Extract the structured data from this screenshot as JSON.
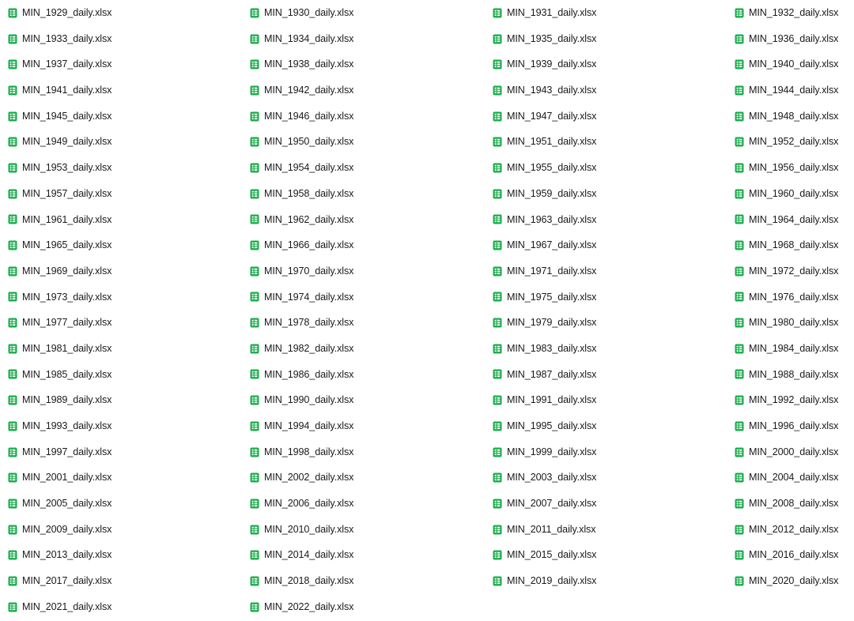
{
  "file_icon": "spreadsheet-file-icon",
  "icon_color": "#1aab4b",
  "files": [
    "MIN_1929_daily.xlsx",
    "MIN_1930_daily.xlsx",
    "MIN_1931_daily.xlsx",
    "MIN_1932_daily.xlsx",
    "MIN_1933_daily.xlsx",
    "MIN_1934_daily.xlsx",
    "MIN_1935_daily.xlsx",
    "MIN_1936_daily.xlsx",
    "MIN_1937_daily.xlsx",
    "MIN_1938_daily.xlsx",
    "MIN_1939_daily.xlsx",
    "MIN_1940_daily.xlsx",
    "MIN_1941_daily.xlsx",
    "MIN_1942_daily.xlsx",
    "MIN_1943_daily.xlsx",
    "MIN_1944_daily.xlsx",
    "MIN_1945_daily.xlsx",
    "MIN_1946_daily.xlsx",
    "MIN_1947_daily.xlsx",
    "MIN_1948_daily.xlsx",
    "MIN_1949_daily.xlsx",
    "MIN_1950_daily.xlsx",
    "MIN_1951_daily.xlsx",
    "MIN_1952_daily.xlsx",
    "MIN_1953_daily.xlsx",
    "MIN_1954_daily.xlsx",
    "MIN_1955_daily.xlsx",
    "MIN_1956_daily.xlsx",
    "MIN_1957_daily.xlsx",
    "MIN_1958_daily.xlsx",
    "MIN_1959_daily.xlsx",
    "MIN_1960_daily.xlsx",
    "MIN_1961_daily.xlsx",
    "MIN_1962_daily.xlsx",
    "MIN_1963_daily.xlsx",
    "MIN_1964_daily.xlsx",
    "MIN_1965_daily.xlsx",
    "MIN_1966_daily.xlsx",
    "MIN_1967_daily.xlsx",
    "MIN_1968_daily.xlsx",
    "MIN_1969_daily.xlsx",
    "MIN_1970_daily.xlsx",
    "MIN_1971_daily.xlsx",
    "MIN_1972_daily.xlsx",
    "MIN_1973_daily.xlsx",
    "MIN_1974_daily.xlsx",
    "MIN_1975_daily.xlsx",
    "MIN_1976_daily.xlsx",
    "MIN_1977_daily.xlsx",
    "MIN_1978_daily.xlsx",
    "MIN_1979_daily.xlsx",
    "MIN_1980_daily.xlsx",
    "MIN_1981_daily.xlsx",
    "MIN_1982_daily.xlsx",
    "MIN_1983_daily.xlsx",
    "MIN_1984_daily.xlsx",
    "MIN_1985_daily.xlsx",
    "MIN_1986_daily.xlsx",
    "MIN_1987_daily.xlsx",
    "MIN_1988_daily.xlsx",
    "MIN_1989_daily.xlsx",
    "MIN_1990_daily.xlsx",
    "MIN_1991_daily.xlsx",
    "MIN_1992_daily.xlsx",
    "MIN_1993_daily.xlsx",
    "MIN_1994_daily.xlsx",
    "MIN_1995_daily.xlsx",
    "MIN_1996_daily.xlsx",
    "MIN_1997_daily.xlsx",
    "MIN_1998_daily.xlsx",
    "MIN_1999_daily.xlsx",
    "MIN_2000_daily.xlsx",
    "MIN_2001_daily.xlsx",
    "MIN_2002_daily.xlsx",
    "MIN_2003_daily.xlsx",
    "MIN_2004_daily.xlsx",
    "MIN_2005_daily.xlsx",
    "MIN_2006_daily.xlsx",
    "MIN_2007_daily.xlsx",
    "MIN_2008_daily.xlsx",
    "MIN_2009_daily.xlsx",
    "MIN_2010_daily.xlsx",
    "MIN_2011_daily.xlsx",
    "MIN_2012_daily.xlsx",
    "MIN_2013_daily.xlsx",
    "MIN_2014_daily.xlsx",
    "MIN_2015_daily.xlsx",
    "MIN_2016_daily.xlsx",
    "MIN_2017_daily.xlsx",
    "MIN_2018_daily.xlsx",
    "MIN_2019_daily.xlsx",
    "MIN_2020_daily.xlsx",
    "MIN_2021_daily.xlsx",
    "MIN_2022_daily.xlsx"
  ]
}
